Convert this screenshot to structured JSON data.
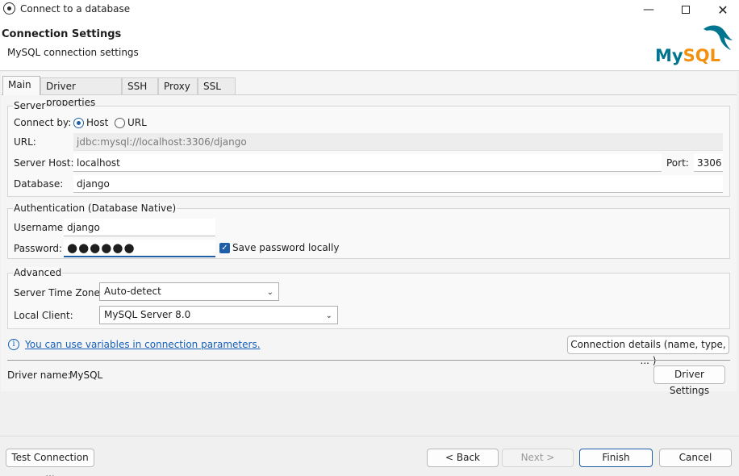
{
  "window": {
    "title": "Connect to a database"
  },
  "header": {
    "title": "Connection Settings",
    "subtitle": "MySQL connection settings",
    "logo_text": "MySQL"
  },
  "tabs": [
    {
      "label": "Main",
      "active": true
    },
    {
      "label": "Driver properties"
    },
    {
      "label": "SSH"
    },
    {
      "label": "Proxy"
    },
    {
      "label": "SSL"
    }
  ],
  "server": {
    "legend": "Server",
    "connect_by_label": "Connect by:",
    "host_option": "Host",
    "url_option": "URL",
    "selected": "Host",
    "url_label": "URL:",
    "url_value": "jdbc:mysql://localhost:3306/django",
    "host_label": "Server Host:",
    "host_value": "localhost",
    "port_label": "Port:",
    "port_value": "3306",
    "database_label": "Database:",
    "database_value": "django"
  },
  "auth": {
    "legend": "Authentication (Database Native)",
    "username_label": "Username:",
    "username_value": "django",
    "password_label": "Password:",
    "password_value": "●●●●●●",
    "save_password_label": "Save password locally",
    "save_password_checked": true
  },
  "advanced": {
    "legend": "Advanced",
    "timezone_label": "Server Time Zone:",
    "timezone_value": "Auto-detect",
    "client_label": "Local Client:",
    "client_value": "MySQL Server 8.0"
  },
  "info": {
    "link_text": "You can use variables in connection parameters.",
    "details_button": "Connection details (name, type, ... )"
  },
  "driver": {
    "label": "Driver name:",
    "value": "MySQL",
    "settings_button": "Driver Settings"
  },
  "footer": {
    "test": "Test Connection ...",
    "back": "< Back",
    "next": "Next >",
    "finish": "Finish",
    "cancel": "Cancel"
  },
  "colors": {
    "accent": "#1f5fa8",
    "mysql_teal": "#00758f",
    "mysql_orange": "#f29111"
  },
  "icons": {
    "minimize": "minimize-icon",
    "maximize": "maximize-icon",
    "close": "close-icon",
    "info": "info-icon",
    "chevron": "chevron-down-icon"
  }
}
